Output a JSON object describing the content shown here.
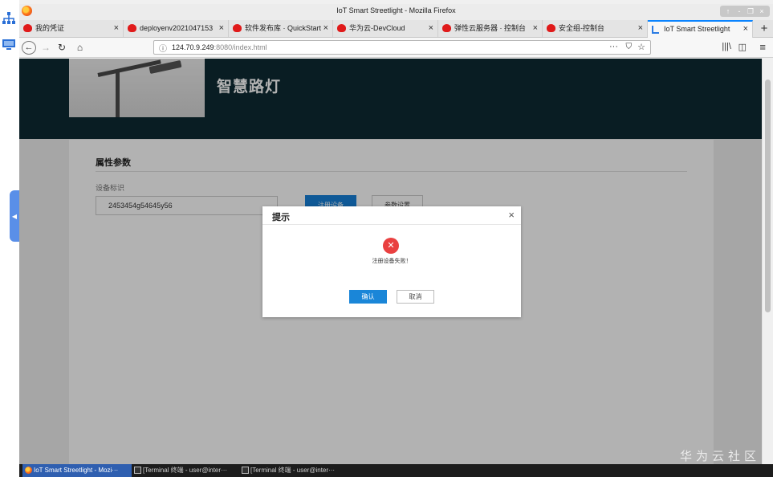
{
  "window": {
    "title": "IoT Smart Streetlight - Mozilla Firefox",
    "controls": [
      "↑",
      "-",
      "❐",
      "×"
    ]
  },
  "tabs": [
    {
      "label": "我的凭证",
      "active": false
    },
    {
      "label": "deployenv2021047153",
      "active": false
    },
    {
      "label": "软件发布库 · QuickStart",
      "active": false
    },
    {
      "label": "华为云-DevCloud",
      "active": false
    },
    {
      "label": "弹性云服务器 · 控制台",
      "active": false
    },
    {
      "label": "安全组-控制台",
      "active": false
    },
    {
      "label": "IoT Smart Streetlight",
      "active": true
    }
  ],
  "navbar": {
    "url_host": "124.70.9.249",
    "url_rest": ":8080/index.html",
    "more": "···"
  },
  "page": {
    "site_title": "智慧路灯",
    "card_title": "属性参数",
    "field_label": "设备标识",
    "field_value": "2453454g54645y56",
    "register_button": "注册设备",
    "param_button": "参数设置"
  },
  "dialog": {
    "title": "提示",
    "close": "×",
    "error_icon": "✕",
    "message": "注册设备失败！",
    "ok": "确认",
    "cancel": "取消"
  },
  "watermark": "华为云社区",
  "taskbar": [
    {
      "label": "IoT Smart Streetlight - Mozi···",
      "icon": "firefox-icon",
      "active": true
    },
    {
      "label": "[Terminal 终端 - user@inter···",
      "icon": "terminal-icon",
      "active": false
    },
    {
      "label": "[Terminal 终端 - user@inter···",
      "icon": "terminal-icon",
      "active": false
    }
  ],
  "colors": {
    "header_bg": "#0e2a33",
    "primary_button": "#1680d9",
    "error": "#e94040",
    "active_tab_accent": "#0a84ff",
    "taskbar_active": "#2f5fb0"
  }
}
